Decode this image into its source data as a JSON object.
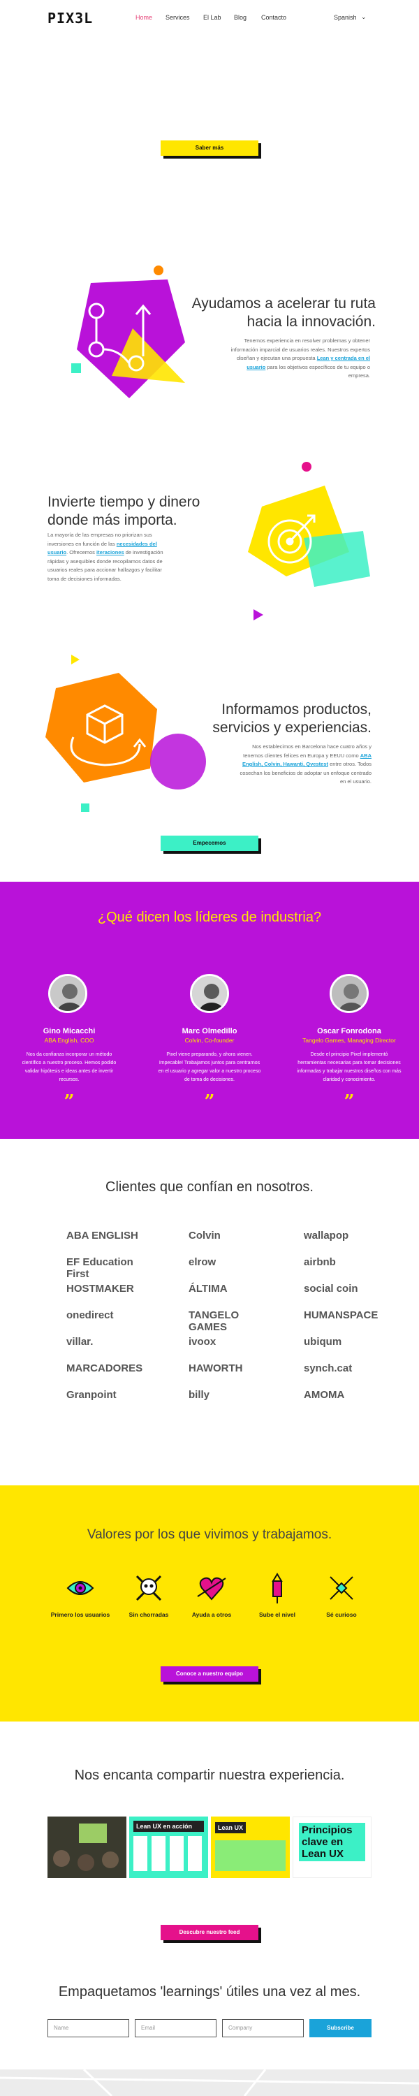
{
  "header": {
    "logo": "PIX3L",
    "nav": [
      "Home",
      "Services",
      "El Lab",
      "Blog",
      "Contacto"
    ],
    "language": "Spanish"
  },
  "hero": {
    "button": "Saber más"
  },
  "features": [
    {
      "title_l1": "Ayudamos a acelerar tu ruta",
      "title_l2": "hacia la innovación.",
      "text_pre": "Tenemos experiencia en resolver problemas y obtener información imparcial de usuarios reales. Nuestros expertos diseñan y ejecutan una propuesta",
      "link": "Lean y centrada en el usuario",
      "text_post": "para los objetivos específicos de tu equipo o empresa."
    },
    {
      "title_l1": "Invierte tiempo y dinero",
      "title_l2": "donde más importa.",
      "text_pre": "La mayoría de las empresas no priorizan sus inversiones en función de las",
      "link1": "necesidades del usuario",
      "text_mid": ". Ofrecemos",
      "link2": "iteraciones",
      "text_post": "de investigación rápidas y asequibles donde recopilamos datos de usuarios reales para accionar hallazgos y facilitar toma de decisiones informadas."
    },
    {
      "title_l1": "Informamos productos,",
      "title_l2": "servicios y experiencias.",
      "text_pre": "Nos establecimos en Barcelona hace cuatro años y tenemos clientes felices en Europa y EEUU como",
      "links": "ABA English, Colvin, Hawanti, Qvestest",
      "text_post": "entre otros. Todos cosechan los beneficios de adoptar un enfoque centrado en el usuario."
    }
  ],
  "cta_button": "Empecemos",
  "testimonials": {
    "title": "¿Qué dicen los líderes de industria?",
    "people": [
      {
        "name": "Gino Micacchi",
        "role": "ABA English, COO",
        "quote": "Nos da confianza incorporar un método científico a nuestro proceso. Hemos podido validar hipótesis e ideas antes de invertir recursos."
      },
      {
        "name": "Marc Olmedillo",
        "role": "Colvin, Co-founder",
        "quote": "Pixel viene preparando, y ahora vienen. Impecable! Trabajamos juntos para centrarnos en el usuario y agregar valor a nuestro proceso de toma de decisiones."
      },
      {
        "name": "Oscar Fonrodona",
        "role": "Tangelo Games, Managing Director",
        "quote": "Desde el principio Pixel implementó herramientas necesarias para tomar decisiones informadas y trabajar nuestros diseños con más claridad y conocimiento."
      }
    ]
  },
  "clients": {
    "title": "Clientes que confían en nosotros.",
    "logos": [
      "ABA ENGLISH",
      "Colvin",
      "wallapop",
      "EF Education First",
      "elrow",
      "airbnb",
      "HOSTMAKER",
      "ÁLTIMA",
      "social coin",
      "onedirect",
      "TANGELO GAMES",
      "HUMANSPACE",
      "villar.",
      "ivoox",
      "ubiqum",
      "MARCADORES",
      "HAWORTH",
      "synch.cat",
      "Granpoint",
      "billy",
      "AMOMA"
    ]
  },
  "values": {
    "title": "Valores por los que vivimos y trabajamos.",
    "items": [
      "Primero los usuarios",
      "Sin chorradas",
      "Ayuda a otros",
      "Sube el nivel",
      "Sé curioso"
    ],
    "button": "Conoce a nuestro equipo"
  },
  "share": {
    "title": "Nos encanta compartir nuestra experiencia.",
    "cards": [
      {
        "heading": "Lean UX en acción"
      },
      {
        "heading": "Lean UX"
      },
      {
        "heading": "Principios clave en Lean UX"
      }
    ],
    "button": "Descubre nuestro feed"
  },
  "newsletter": {
    "title": "Empaquetamos 'learnings' útiles una vez al mes.",
    "name_placeholder": "Name",
    "email_placeholder": "Email",
    "company_placeholder": "Company",
    "button": "Subscribe"
  },
  "colors": {
    "purple": "#b912d9",
    "yellow": "#ffe600",
    "teal": "#3cf0c6",
    "pink": "#e5118b",
    "orange": "#ff8a00",
    "link": "#1aa3d9"
  }
}
